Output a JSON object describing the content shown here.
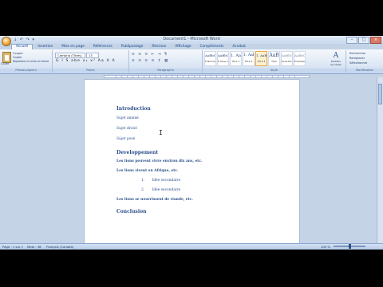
{
  "window": {
    "title": "Document1 - Microsoft Word"
  },
  "quick_access": "↓ ↶ ↷ ▾",
  "window_buttons": [
    "–",
    "□",
    "×"
  ],
  "tabs": [
    "Accueil",
    "Insertion",
    "Mise en page",
    "Références",
    "Publipostage",
    "Révision",
    "Affichage",
    "Compléments",
    "Acrobat"
  ],
  "ribbon": {
    "clipboard": {
      "paste": "Coller",
      "cut": "Couper",
      "copy": "Copier",
      "format_painter": "Reproduire la mise en forme",
      "label": "Presse-papiers"
    },
    "font": {
      "name": "Cambria (Titres)",
      "size": "13",
      "format_row": "G I S abe x₂ x² Aa  A  A",
      "label": "Police"
    },
    "paragraph": {
      "row1": "≡ ≡ ≡ ⇤ ⇥ ¶",
      "row2": "≡ ≡ ≡ ≡ ↕ ▦",
      "label": "Paragraphe"
    },
    "styles": {
      "label": "Style",
      "items": [
        {
          "preview": "AaBbCcDc",
          "name": "¶ Normal"
        },
        {
          "preview": "AaBbCcDc",
          "name": "¶ Sans inte..."
        },
        {
          "preview": "1. AaBl",
          "name": "Titre 1"
        },
        {
          "preview": "1.  AaBb",
          "name": "Titre 2"
        },
        {
          "preview": "1. AaBbC",
          "name": "Titre 3"
        },
        {
          "preview": "AaB",
          "name": "Titre"
        },
        {
          "preview": "AaBbCc.",
          "name": "Sous-titre"
        },
        {
          "preview": "AaBbCcDc",
          "name": "Emphase..."
        }
      ],
      "change_button": "Modifier les styles"
    },
    "editing": {
      "find": "Rechercher",
      "replace": "Remplacer",
      "select": "Sélectionner",
      "label": "Modification"
    }
  },
  "document": {
    "content": [
      {
        "kind": "heading",
        "text": "Introduction"
      },
      {
        "kind": "para",
        "text": "Sujet amené"
      },
      {
        "kind": "para",
        "text": "Sujet divisé"
      },
      {
        "kind": "para",
        "text": "Sujet posé"
      },
      {
        "kind": "heading",
        "text": "Developpement"
      },
      {
        "kind": "para",
        "text": "Les lions peuvent vivre environ dix ans, etc."
      },
      {
        "kind": "para",
        "text": "Les lions vivent en Afrique, etc."
      },
      {
        "kind": "list",
        "number": "1.",
        "text": "Idée secondaire"
      },
      {
        "kind": "list",
        "number": "2.",
        "text": "Idée secondaire"
      },
      {
        "kind": "para",
        "text": "Les lions se nourrissent de viande, etc."
      },
      {
        "kind": "heading",
        "text": "Conclusion"
      }
    ]
  },
  "status_bar": {
    "page": "Page : 1 sur 1",
    "words": "Mots : 38",
    "language": "Français (Canada)",
    "zoom": "100 %"
  }
}
